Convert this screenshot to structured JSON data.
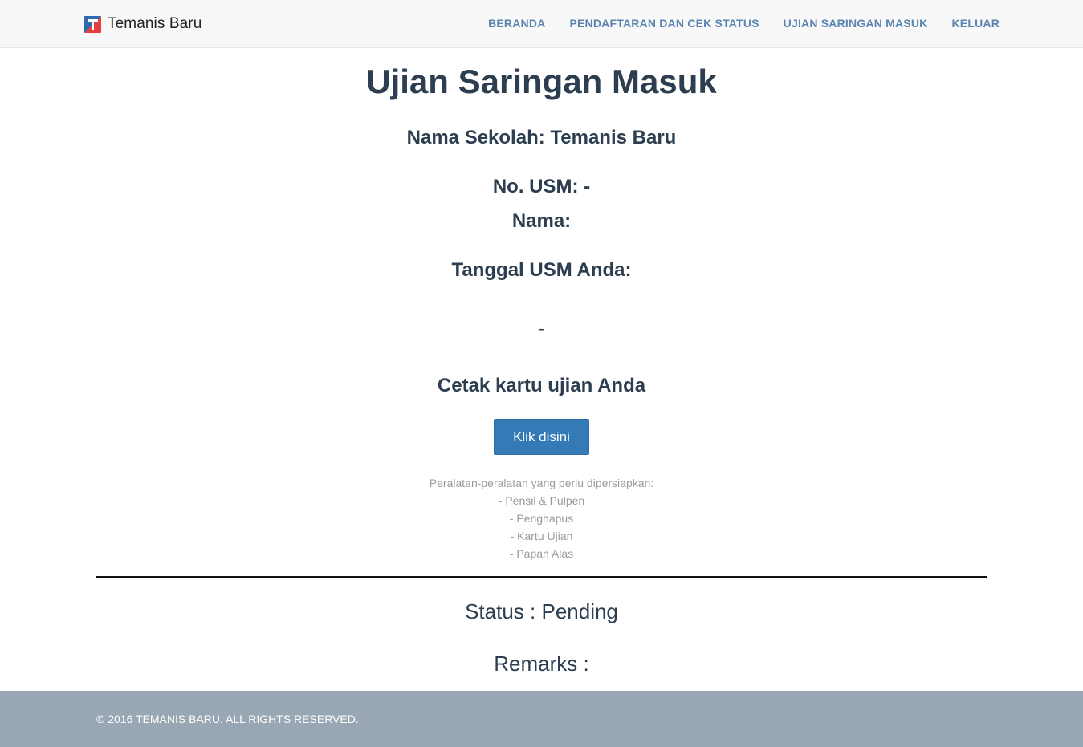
{
  "navbar": {
    "brand": "Temanis Baru",
    "links": [
      {
        "label": "BERANDA"
      },
      {
        "label": "PENDAFTARAN DAN CEK STATUS"
      },
      {
        "label": "UJIAN SARINGAN MASUK"
      },
      {
        "label": "KELUAR"
      }
    ]
  },
  "main": {
    "title": "Ujian Saringan Masuk",
    "school": "Nama Sekolah: Temanis Baru",
    "usm_no": "No. USM: -",
    "name": "Nama:",
    "date_label": "Tanggal USM Anda:",
    "date_value": "-",
    "print_heading": "Cetak kartu ujian Anda",
    "print_button": "Klik disini",
    "equipment": {
      "intro": "Peralatan-peralatan yang perlu dipersiapkan:",
      "items": [
        "- Pensil & Pulpen",
        "- Penghapus",
        "- Kartu Ujian",
        "- Papan Alas"
      ]
    },
    "status": "Status : Pending",
    "remarks": "Remarks :"
  },
  "footer": {
    "copyright": "© 2016 TEMANIS BARU. ALL RIGHTS RESERVED."
  },
  "colors": {
    "nav_link": "#5b84b1",
    "button": "#337ab7",
    "footer": "#99a6b3",
    "heading": "#2c3e50"
  }
}
